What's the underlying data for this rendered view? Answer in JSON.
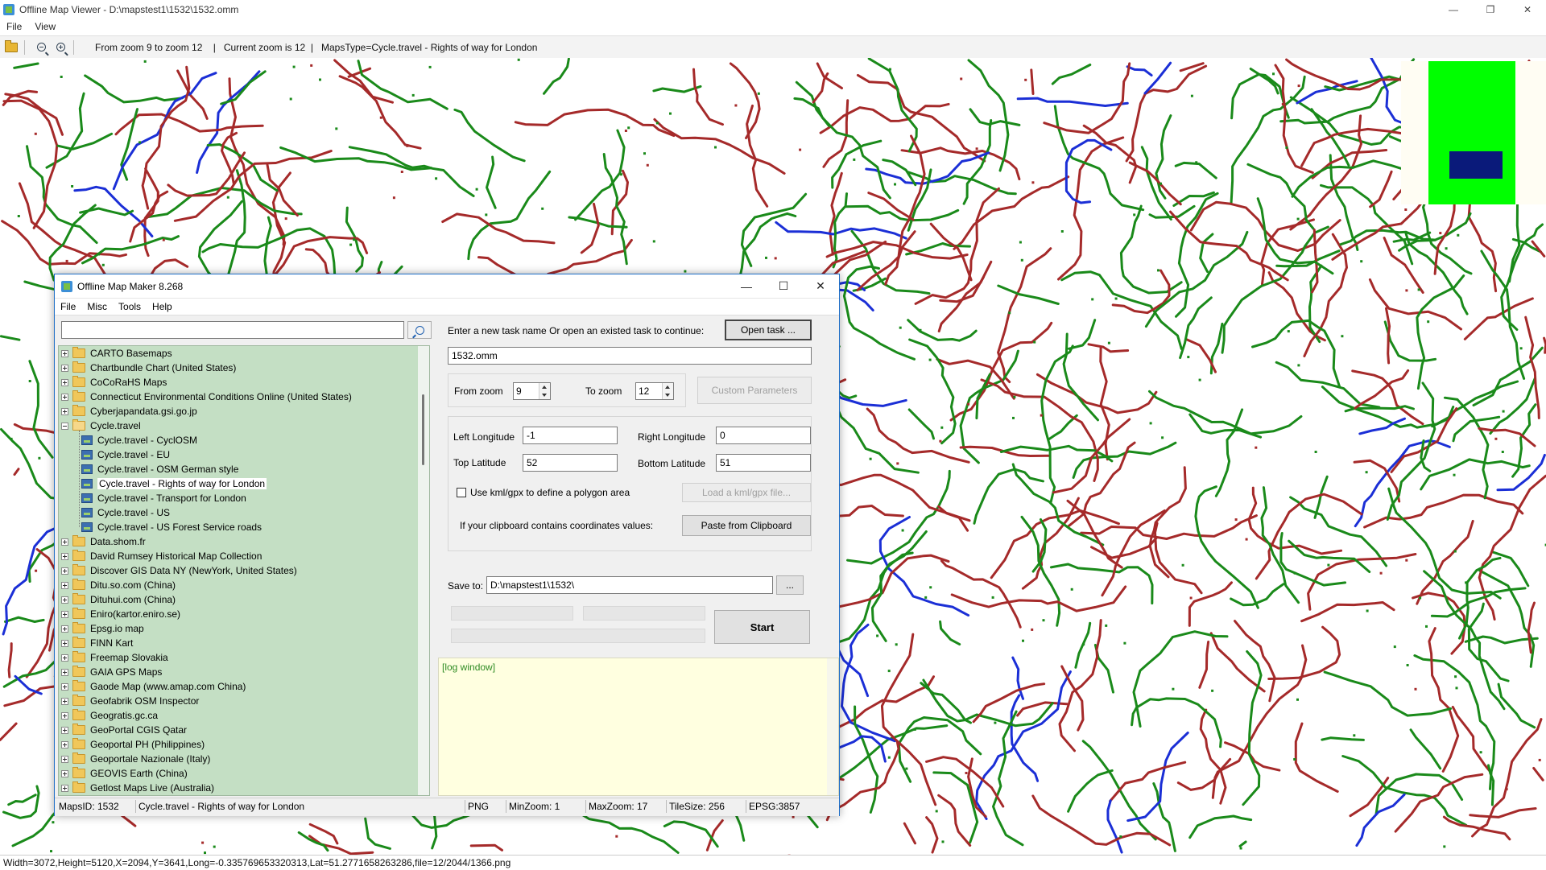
{
  "viewer": {
    "title": "Offline Map Viewer - D:\\mapstest1\\1532\\1532.omm",
    "menu": [
      "File",
      "View"
    ],
    "toolbar_info": "From zoom 9 to zoom 12    |   Current zoom is 12  |   MapsType=Cycle.travel - Rights of way for London",
    "status": "Width=3072,Height=5120,X=2094,Y=3641,Long=-0.335769653320313,Lat=51.2771658263286,file=12/2044/1366.png",
    "colors": {
      "route_red": "#a52a2a",
      "route_green": "#1a8a1a",
      "route_blue": "#1b2fd6",
      "overview_green": "#00ff00",
      "overview_box": "#0a1a7a"
    }
  },
  "dialog": {
    "title": "Offline Map Maker 8.268",
    "menu": [
      "File",
      "Misc",
      "Tools",
      "Help"
    ],
    "search": {
      "value": "",
      "placeholder": ""
    },
    "tree": [
      {
        "label": "CARTO Basemaps",
        "type": "folder",
        "expanded": false
      },
      {
        "label": "Chartbundle Chart (United States)",
        "type": "folder",
        "expanded": false
      },
      {
        "label": "CoCoRaHS Maps",
        "type": "folder",
        "expanded": false
      },
      {
        "label": "Connecticut Environmental Conditions Online (United States)",
        "type": "folder",
        "expanded": false
      },
      {
        "label": "Cyberjapandata.gsi.go.jp",
        "type": "folder",
        "expanded": false
      },
      {
        "label": "Cycle.travel",
        "type": "folder",
        "expanded": true
      },
      {
        "label": "Cycle.travel - CyclOSM",
        "type": "map"
      },
      {
        "label": "Cycle.travel - EU",
        "type": "map"
      },
      {
        "label": "Cycle.travel - OSM German style",
        "type": "map"
      },
      {
        "label": "Cycle.travel - Rights of way for London",
        "type": "map",
        "selected": true
      },
      {
        "label": "Cycle.travel - Transport for London",
        "type": "map"
      },
      {
        "label": "Cycle.travel - US",
        "type": "map"
      },
      {
        "label": "Cycle.travel - US Forest Service roads",
        "type": "map"
      },
      {
        "label": "Data.shom.fr",
        "type": "folder",
        "expanded": false
      },
      {
        "label": "David Rumsey Historical Map Collection",
        "type": "folder",
        "expanded": false
      },
      {
        "label": "Discover GIS Data NY (NewYork, United States)",
        "type": "folder",
        "expanded": false
      },
      {
        "label": "Ditu.so.com (China)",
        "type": "folder",
        "expanded": false
      },
      {
        "label": "Dituhui.com (China)",
        "type": "folder",
        "expanded": false
      },
      {
        "label": "Eniro(kartor.eniro.se)",
        "type": "folder",
        "expanded": false
      },
      {
        "label": "Epsg.io map",
        "type": "folder",
        "expanded": false
      },
      {
        "label": "FINN Kart",
        "type": "folder",
        "expanded": false
      },
      {
        "label": "Freemap Slovakia",
        "type": "folder",
        "expanded": false
      },
      {
        "label": "GAIA GPS Maps",
        "type": "folder",
        "expanded": false
      },
      {
        "label": "Gaode Map (www.amap.com China)",
        "type": "folder",
        "expanded": false
      },
      {
        "label": "Geofabrik OSM Inspector",
        "type": "folder",
        "expanded": false
      },
      {
        "label": "Geogratis.gc.ca",
        "type": "folder",
        "expanded": false
      },
      {
        "label": "GeoPortal CGIS Qatar",
        "type": "folder",
        "expanded": false
      },
      {
        "label": "Geoportal PH (Philippines)",
        "type": "folder",
        "expanded": false
      },
      {
        "label": "Geoportale Nazionale (Italy)",
        "type": "folder",
        "expanded": false
      },
      {
        "label": "GEOVIS Earth (China)",
        "type": "folder",
        "expanded": false
      },
      {
        "label": "Getlost Maps Live (Australia)",
        "type": "folder",
        "expanded": false
      }
    ],
    "task": {
      "prompt": "Enter a new task name Or open an existed task to continue:",
      "open_button": "Open task ...",
      "task_name": "1532.omm"
    },
    "zoom": {
      "from_label": "From zoom",
      "from_value": "9",
      "to_label": "To zoom",
      "to_value": "12",
      "custom_button": "Custom Parameters"
    },
    "coords": {
      "left_label": "Left Longitude",
      "left_value": "-1",
      "right_label": "Right Longitude",
      "right_value": "0",
      "top_label": "Top Latitude",
      "top_value": "52",
      "bottom_label": "Bottom Latitude",
      "bottom_value": "51",
      "kml_label": "Use kml/gpx to define a polygon area",
      "kml_checked": false,
      "kml_button": "Load a kml/gpx file...",
      "clipboard_label": "If your clipboard contains coordinates values:",
      "clipboard_button": "Paste from Clipboard"
    },
    "save": {
      "label": "Save to:",
      "path": "D:\\mapstest1\\1532\\",
      "browse_button": "...",
      "start_button": "Start"
    },
    "log_text": "[log window]",
    "status": {
      "maps_id": "MapsID: 1532",
      "map_name": "Cycle.travel - Rights of way for London",
      "format": "PNG",
      "min_zoom": "MinZoom: 1",
      "max_zoom": "MaxZoom: 17",
      "tile_size": "TileSize: 256",
      "epsg": "EPSG:3857"
    }
  }
}
